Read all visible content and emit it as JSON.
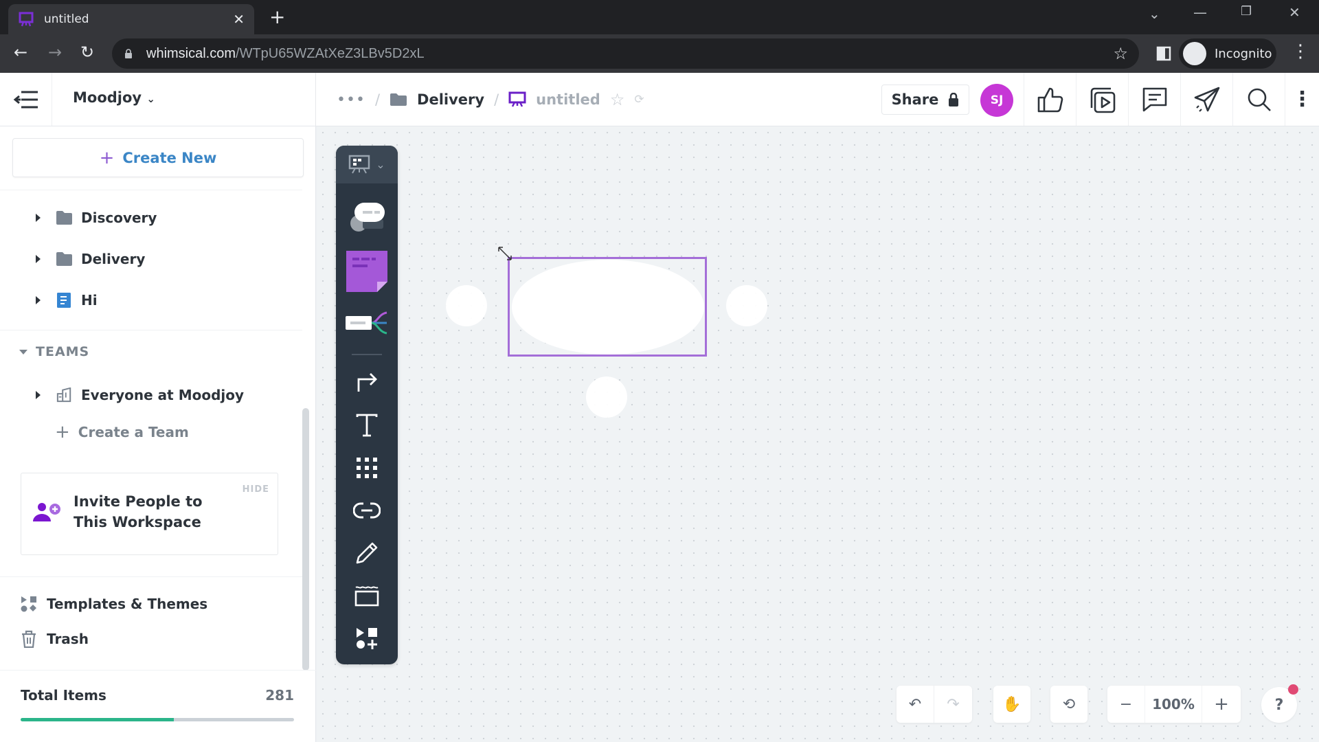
{
  "browser": {
    "tab_title": "untitled",
    "url_host": "whimsical.com",
    "url_path": "/WTpU65WZAtXeZ3LBv5D2xL",
    "profile_label": "Incognito"
  },
  "header": {
    "workspace": "Moodjoy",
    "breadcrumb_more": "•••",
    "breadcrumb_sep": "/",
    "breadcrumb_folder": "Delivery",
    "breadcrumb_file": "untitled",
    "share_label": "Share",
    "avatar_initials": "SJ",
    "avatar_color": "#c637d6"
  },
  "sidebar": {
    "create_new": "Create New",
    "items": [
      {
        "label": "Discovery",
        "icon": "folder-icon"
      },
      {
        "label": "Delivery",
        "icon": "folder-icon"
      },
      {
        "label": "Hi",
        "icon": "document-icon"
      }
    ],
    "teams_heading": "TEAMS",
    "team": "Everyone at Moodjoy",
    "create_team": "Create a Team",
    "invite_hide": "HIDE",
    "invite_text": "Invite People to This Workspace",
    "templates": "Templates & Themes",
    "trash": "Trash",
    "total_label": "Total Items",
    "total_count": "281",
    "usage_fraction": 0.56
  },
  "toolbar": {
    "tools": [
      "mind-map",
      "sticky-note",
      "flowchart",
      "connector",
      "text",
      "grid",
      "link",
      "pencil",
      "section",
      "shapes"
    ]
  },
  "controls": {
    "zoom": "100%",
    "help": "?"
  },
  "colors": {
    "accent": "#a46ed8",
    "progress": "#2bb58a",
    "link": "#3b86c6"
  }
}
